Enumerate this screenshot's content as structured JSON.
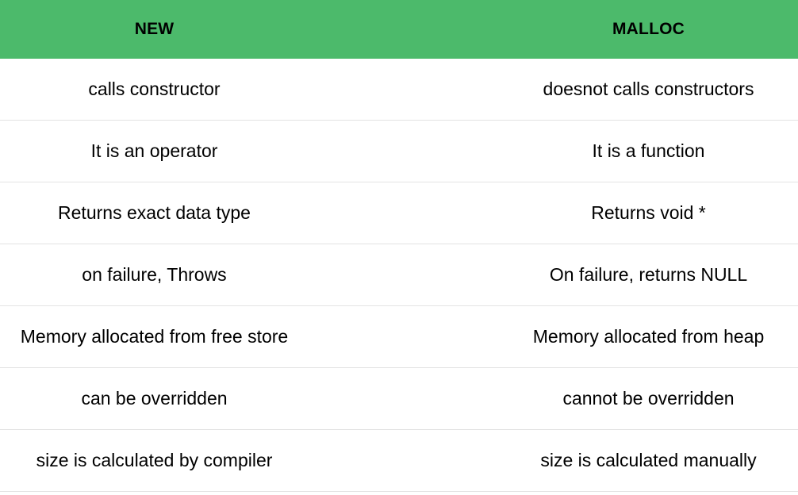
{
  "table": {
    "headers": [
      "NEW",
      "MALLOC"
    ],
    "rows": [
      [
        "calls constructor",
        "doesnot calls constructors"
      ],
      [
        "It is an operator",
        "It is a function"
      ],
      [
        "Returns exact data type",
        "Returns void *"
      ],
      [
        "on failure, Throws",
        "On failure, returns NULL"
      ],
      [
        "Memory allocated from free store",
        "Memory allocated from heap"
      ],
      [
        "can be overridden",
        "cannot be overridden"
      ],
      [
        "size is calculated by compiler",
        "size is calculated manually"
      ]
    ]
  },
  "colors": {
    "header_background": "#4cba6b",
    "row_divider": "#e3e3e3",
    "text": "#000000"
  }
}
